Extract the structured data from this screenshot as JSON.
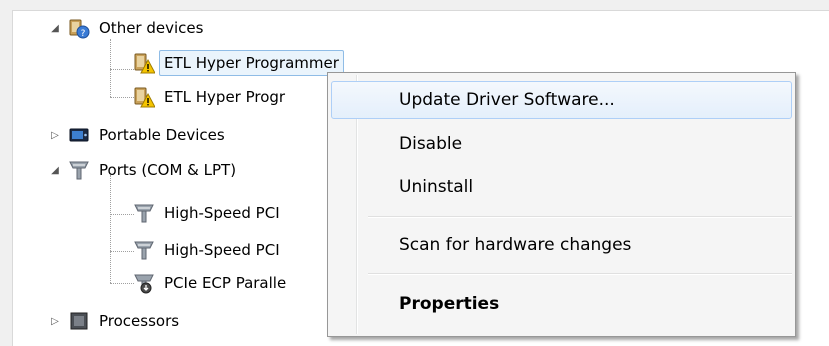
{
  "tree": {
    "other_devices": "Other devices",
    "etl_1": "ETL Hyper Programmer",
    "etl_2": "ETL Hyper Progr",
    "portable_devices": "Portable Devices",
    "ports": "Ports (COM & LPT)",
    "port_1": "High-Speed PCI",
    "port_2": "High-Speed PCI",
    "port_3": "PCIe ECP Paralle",
    "processors": "Processors"
  },
  "context_menu": {
    "update_driver": "Update Driver Software...",
    "disable": "Disable",
    "uninstall": "Uninstall",
    "scan": "Scan for hardware changes",
    "properties": "Properties"
  },
  "colors": {
    "selection_bg": "#eaf4fc",
    "selection_border": "#8fbce6",
    "menu_hover_border": "#aecff7",
    "warning": "#f5c400"
  },
  "icons": {
    "unknown_device": "unknown-device-warning-icon",
    "portable": "portable-device-icon",
    "port": "port-connector-icon",
    "processor": "processor-chip-icon"
  }
}
